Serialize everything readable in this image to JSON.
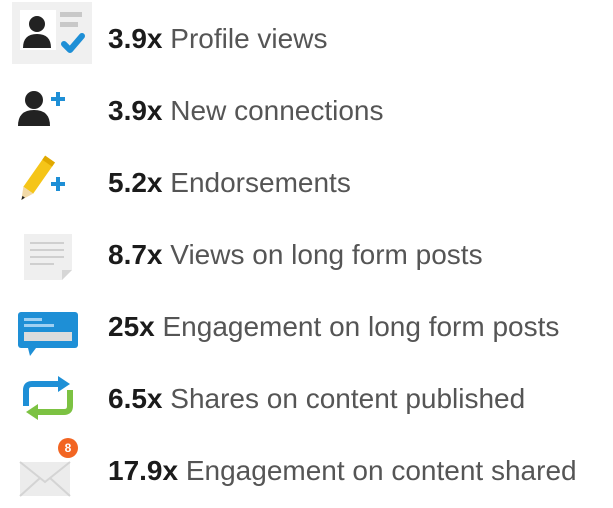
{
  "stats": [
    {
      "multiplier": "3.9x",
      "label": "Profile views",
      "icon": "profile-card-check-icon"
    },
    {
      "multiplier": "3.9x",
      "label": "New connections",
      "icon": "add-person-icon"
    },
    {
      "multiplier": "5.2x",
      "label": "Endorsements",
      "icon": "pencil-plus-icon"
    },
    {
      "multiplier": "8.7x",
      "label": "Views on long form posts",
      "icon": "document-icon"
    },
    {
      "multiplier": "25x",
      "label": "Engagement on long form posts",
      "icon": "comment-bubble-icon"
    },
    {
      "multiplier": "6.5x",
      "label": "Shares on content published",
      "icon": "reshare-arrows-icon"
    },
    {
      "multiplier": "17.9x",
      "label": "Engagement on content shared",
      "icon": "envelope-badge-icon",
      "badge": "8"
    }
  ],
  "colors": {
    "accent_blue": "#1e8fd6",
    "green": "#7cc242",
    "pencil_yellow": "#f5c518",
    "badge_orange": "#f26522",
    "text_dark": "#1b1b1b",
    "text_gray": "#555555"
  }
}
